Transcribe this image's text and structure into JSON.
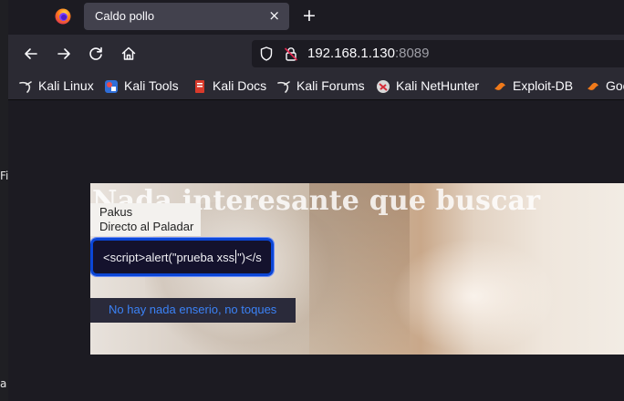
{
  "browser": {
    "tab": {
      "title": "Caldo pollo",
      "close_symbol": "×"
    },
    "new_tab_symbol": "+",
    "url": {
      "host": "192.168.1.130",
      "port": ":8089"
    },
    "bookmarks": [
      {
        "label": "Kali Linux",
        "icon": "kali-dragon-icon"
      },
      {
        "label": "Kali Tools",
        "icon": "kali-tools-icon"
      },
      {
        "label": "Kali Docs",
        "icon": "kali-docs-icon"
      },
      {
        "label": "Kali Forums",
        "icon": "kali-dragon-icon"
      },
      {
        "label": "Kali NetHunter",
        "icon": "nethunter-icon"
      },
      {
        "label": "Exploit-DB",
        "icon": "exploit-db-icon"
      },
      {
        "label": "Goo",
        "icon": "exploit-db-icon"
      }
    ]
  },
  "page": {
    "hero_title": "Nada interesante que buscar",
    "brand_line1": "Pakus",
    "brand_line2": "Directo al Paladar",
    "search_value_before_caret": "<script>alert(\"prueba xss",
    "search_value_after_caret": "\")</s",
    "link_text": "No hay nada enserio, no toques"
  },
  "desktop": {
    "edge_char_1": "Fi",
    "edge_char_2": "a"
  },
  "colors": {
    "accent_focus": "#0b46d6",
    "link": "#3b82f6",
    "chrome_bg": "#2b2a33",
    "tab_bg": "#42414d"
  }
}
